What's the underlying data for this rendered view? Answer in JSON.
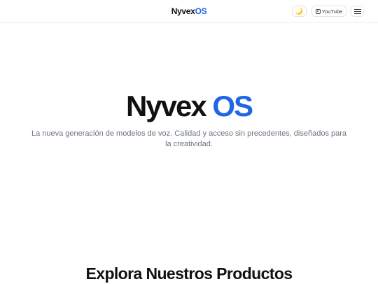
{
  "header": {
    "brand_main": "Nyvex",
    "brand_accent": "OS",
    "theme_icon": "moon-icon",
    "theme_glyph": "🌙",
    "youtube_label": "YouTube",
    "youtube_icon": "youtube-icon",
    "menu_icon": "hamburger-menu-icon"
  },
  "hero": {
    "title_main": "Nyvex",
    "title_accent": "OS",
    "subtitle": "La nueva generación de modelos de voz. Calidad y acceso sin precedentes, diseñados para la creatividad."
  },
  "products": {
    "heading": "Explora Nuestros Productos"
  },
  "colors": {
    "accent": "#1e66e6",
    "text": "#111111",
    "muted": "#6b7280"
  }
}
